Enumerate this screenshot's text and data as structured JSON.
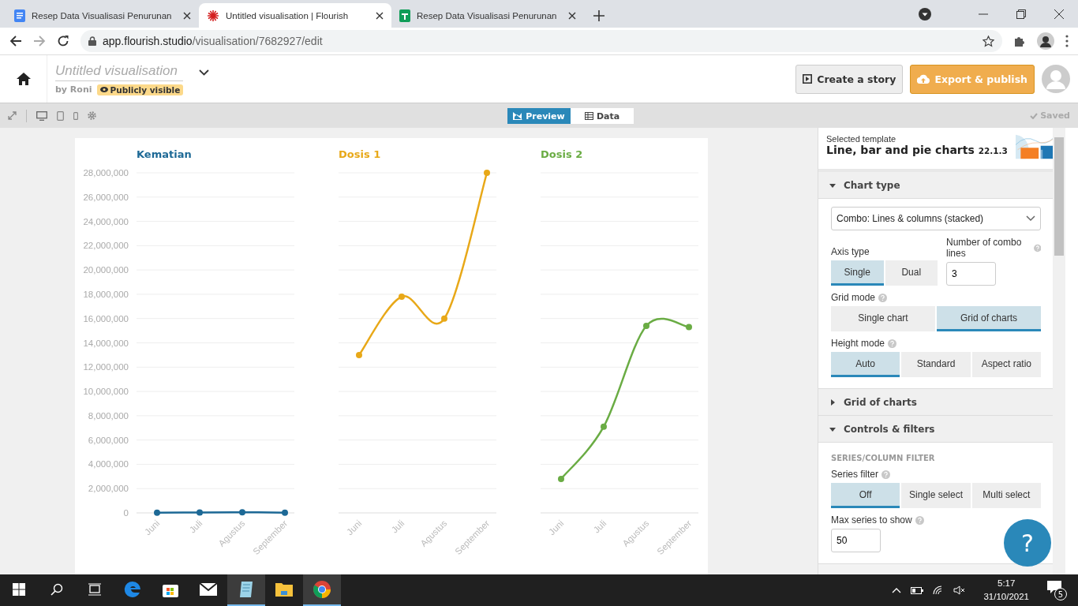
{
  "browser": {
    "tabs": [
      {
        "title": "Resep Data Visualisasi Penurunan",
        "kind": "docs",
        "selected": false
      },
      {
        "title": "Untitled visualisation | Flourish",
        "kind": "flourish",
        "selected": true
      },
      {
        "title": "Resep Data Visualisasi Penurunan",
        "kind": "sheets",
        "selected": false
      }
    ],
    "url_host": "app.flourish.studio",
    "url_path": "/visualisation/7682927/edit"
  },
  "header": {
    "title": "Untitled visualisation",
    "byline": "by Roni",
    "visibility": "Publicly visible",
    "story_button": "Create a story",
    "export_button": "Export & publish"
  },
  "toolbar": {
    "view_tabs": [
      {
        "label": "Preview",
        "selected": true
      },
      {
        "label": "Data",
        "selected": false
      }
    ],
    "status": "Saved"
  },
  "charts": [
    {
      "chart_data": {
        "type": "line",
        "title": "Kematian",
        "grid": true,
        "categories": [
          "Juni",
          "Juli",
          "Agustus",
          "September"
        ],
        "series": [
          {
            "color": "#1d6996",
            "marker": true,
            "values": [
              10000,
              40000,
              50000,
              20000
            ]
          }
        ],
        "ylim": [
          0,
          28000000
        ],
        "yticks": [
          {
            "value": 0,
            "label": "0"
          },
          {
            "value": 2000000,
            "label": "2,000,000"
          },
          {
            "value": 4000000,
            "label": "4,000,000"
          },
          {
            "value": 6000000,
            "label": "6,000,000"
          },
          {
            "value": 8000000,
            "label": "8,000,000"
          },
          {
            "value": 10000000,
            "label": "10,000,000"
          },
          {
            "value": 12000000,
            "label": "12,000,000"
          },
          {
            "value": 14000000,
            "label": "14,000,000"
          },
          {
            "value": 16000000,
            "label": "16,000,000"
          },
          {
            "value": 18000000,
            "label": "18,000,000"
          },
          {
            "value": 20000000,
            "label": "20,000,000"
          },
          {
            "value": 22000000,
            "label": "22,000,000"
          },
          {
            "value": 24000000,
            "label": "24,000,000"
          },
          {
            "value": 26000000,
            "label": "26,000,000"
          },
          {
            "value": 28000000,
            "label": "28,000,000"
          }
        ]
      }
    },
    {
      "chart_data": {
        "type": "line",
        "title": "Dosis 1",
        "grid": true,
        "categories": [
          "Juni",
          "Juli",
          "Agustus",
          "September"
        ],
        "series": [
          {
            "color": "#e8a818",
            "marker": true,
            "values": [
              13000000,
              17800000,
              16000000,
              28000000
            ]
          }
        ],
        "ylim": [
          0,
          28000000
        ]
      }
    },
    {
      "chart_data": {
        "type": "line",
        "title": "Dosis 2",
        "grid": true,
        "categories": [
          "Juni",
          "Juli",
          "Agustus",
          "September"
        ],
        "series": [
          {
            "color": "#6aac44",
            "marker": true,
            "values": [
              2800000,
              7100000,
              15400000,
              15300000
            ]
          }
        ],
        "ylim": [
          0,
          28000000
        ]
      }
    }
  ],
  "panel": {
    "template_label": "Selected template",
    "template_name": "Line, bar and pie charts",
    "template_version": "22.1.3",
    "sections": [
      {
        "title": "Chart type",
        "expanded": true,
        "controls": [
          {
            "kind": "select",
            "value": "Combo: Lines & columns (stacked)"
          },
          {
            "kind": "pair",
            "items": [
              {
                "kind": "segmented",
                "label": "Axis type",
                "options": [
                  {
                    "label": "Single",
                    "selected": true
                  },
                  {
                    "label": "Dual",
                    "selected": false
                  }
                ]
              },
              {
                "kind": "number",
                "label": "Number of combo lines",
                "help": true,
                "value": "3"
              }
            ]
          },
          {
            "kind": "segmented",
            "label": "Grid mode",
            "help": true,
            "options": [
              {
                "label": "Single chart",
                "selected": false
              },
              {
                "label": "Grid of charts",
                "selected": true
              }
            ]
          },
          {
            "kind": "segmented",
            "label": "Height mode",
            "help": true,
            "options": [
              {
                "label": "Auto",
                "selected": true
              },
              {
                "label": "Standard",
                "selected": false
              },
              {
                "label": "Aspect ratio",
                "selected": false
              }
            ]
          }
        ]
      },
      {
        "title": "Grid of charts",
        "expanded": false
      },
      {
        "title": "Controls & filters",
        "expanded": true,
        "controls": [
          {
            "kind": "subheading",
            "label": "SERIES/COLUMN FILTER"
          },
          {
            "kind": "segmented",
            "label": "Series filter",
            "help": true,
            "options": [
              {
                "label": "Off",
                "selected": true
              },
              {
                "label": "Single select",
                "selected": false
              },
              {
                "label": "Multi select",
                "selected": false
              }
            ]
          },
          {
            "kind": "number",
            "label": "Max series to show",
            "help": true,
            "value": "50"
          }
        ]
      }
    ]
  },
  "help_button": "?",
  "taskbar": {
    "apps": [
      {
        "kind": "edge",
        "active": false
      },
      {
        "kind": "store",
        "active": false
      },
      {
        "kind": "mail",
        "active": false
      },
      {
        "kind": "notepad",
        "active": true
      },
      {
        "kind": "explorer",
        "active": false
      },
      {
        "kind": "chrome",
        "active": true
      }
    ],
    "time": "5:17",
    "date": "31/10/2021",
    "notifications": "5"
  }
}
